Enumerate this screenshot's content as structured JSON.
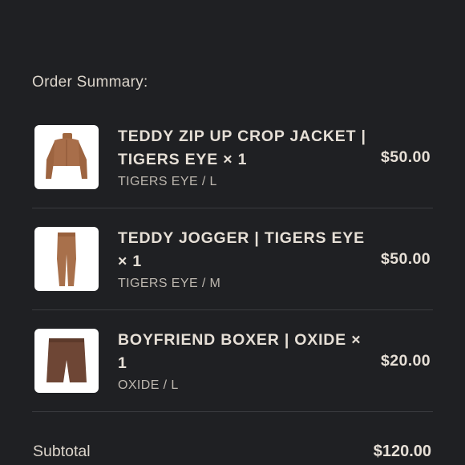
{
  "order_summary": {
    "heading": "Order Summary:",
    "items": [
      {
        "title": "TEDDY ZIP UP CROP JACKET | TIGERS EYE × 1",
        "variant": "TIGERS EYE / L",
        "price": "$50.00",
        "image_icon": "cropped-jacket-icon",
        "color": "#a86e4a"
      },
      {
        "title": "TEDDY JOGGER | TIGERS EYE × 1",
        "variant": "TIGERS EYE / M",
        "price": "$50.00",
        "image_icon": "jogger-pants-icon",
        "color": "#a8704b"
      },
      {
        "title": "BOYFRIEND BOXER | OXIDE × 1",
        "variant": "OXIDE / L",
        "price": "$20.00",
        "image_icon": "boxer-shorts-icon",
        "color": "#6e4635"
      }
    ],
    "subtotal_label": "Subtotal",
    "subtotal_value": "$120.00"
  }
}
